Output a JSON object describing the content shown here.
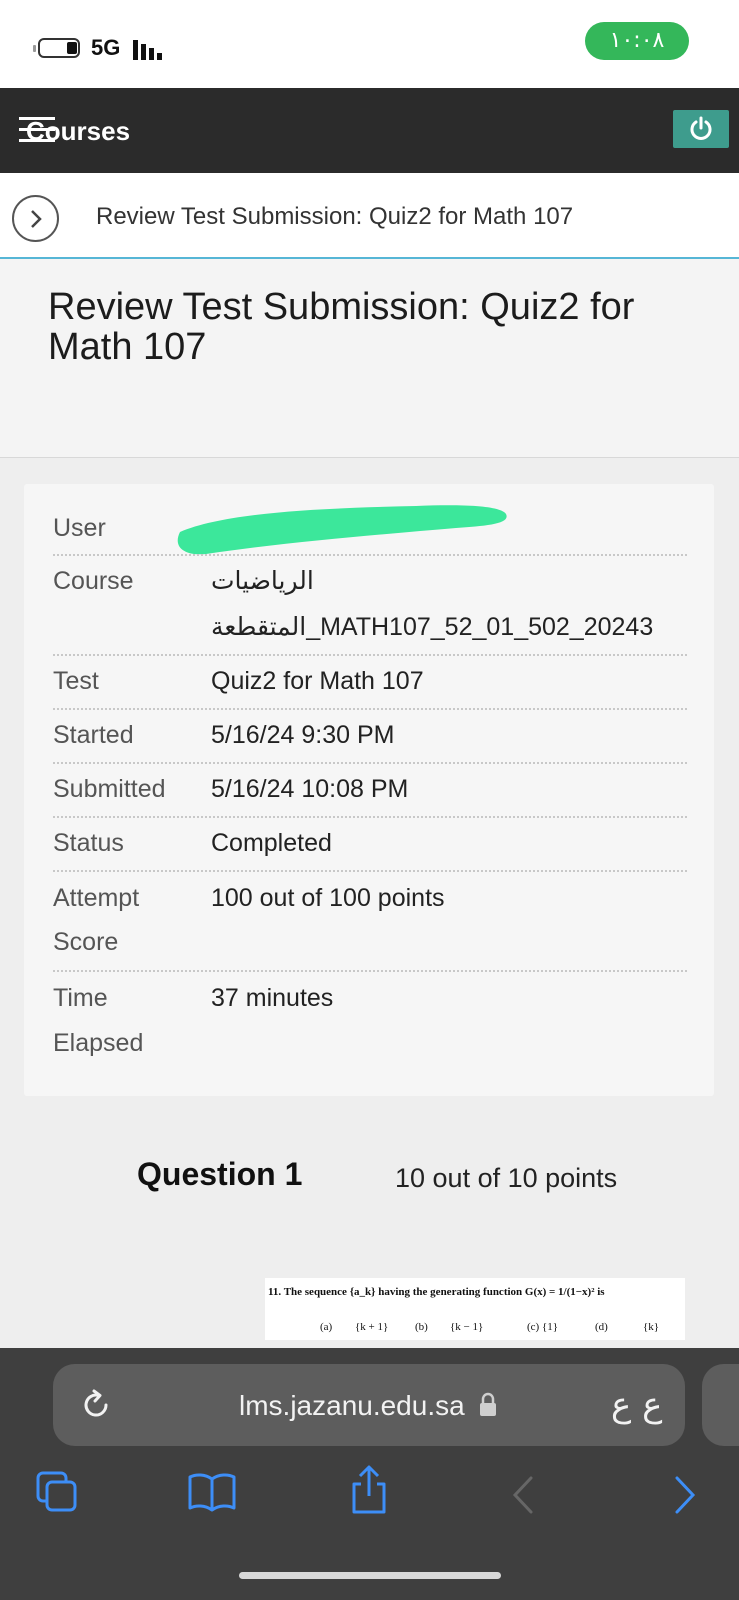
{
  "status_bar": {
    "network": "5G",
    "clock": "١٠:٠٨",
    "accent": "#34b75a"
  },
  "app_bar": {
    "title": "Courses",
    "power_color": "#3e9c8d"
  },
  "breadcrumb": {
    "text": "Review Test Submission: Quiz2 for Math 107"
  },
  "page": {
    "title": "Review Test Submission: Quiz2 for Math 107"
  },
  "details": {
    "user_label": "User",
    "course_label": "Course",
    "course_value_line1": "الرياضيات",
    "course_value_line2": "المتقطعة_MATH107_52_01_502_20243",
    "test_label": "Test",
    "test_value": "Quiz2 for Math 107",
    "started_label": "Started",
    "started_value": "5/16/24 9:30 PM",
    "submitted_label": "Submitted",
    "submitted_value": "5/16/24 10:08 PM",
    "status_label": "Status",
    "status_value": "Completed",
    "attempt_label_line1": "Attempt",
    "attempt_label_line2": "Score",
    "attempt_value": "100 out of 100 points",
    "time_label_line1": "Time",
    "time_label_line2": "Elapsed",
    "time_value": "37 minutes"
  },
  "question": {
    "title": "Question 1",
    "points": "10 out of 10 points",
    "text": "11. The sequence {a_k} having the generating function G(x) = 1/(1−x)² is",
    "options": [
      "(a)",
      "{k + 1}",
      "(b)",
      "{k − 1}",
      "(c) {1}",
      "(d)",
      "{k}"
    ]
  },
  "browser": {
    "url": "lms.jazanu.edu.sa",
    "text_size_icon": "ع ع"
  },
  "icons": {
    "menu": "menu-icon",
    "power": "power-icon",
    "chevron": "chevron-right-icon",
    "reload": "reload-icon",
    "lock": "lock-icon",
    "tabs": "tabs-icon",
    "bookmarks": "book-icon",
    "share": "share-icon",
    "back": "back-arrow-icon",
    "forward": "forward-arrow-icon"
  }
}
